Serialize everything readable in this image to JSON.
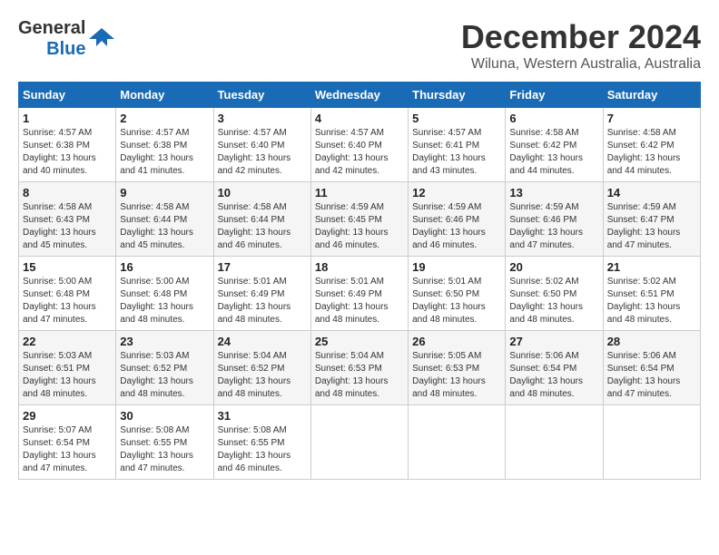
{
  "logo": {
    "line1": "General",
    "line2": "Blue"
  },
  "title": "December 2024",
  "subtitle": "Wiluna, Western Australia, Australia",
  "days_header": [
    "Sunday",
    "Monday",
    "Tuesday",
    "Wednesday",
    "Thursday",
    "Friday",
    "Saturday"
  ],
  "weeks": [
    [
      {
        "day": "1",
        "info": "Sunrise: 4:57 AM\nSunset: 6:38 PM\nDaylight: 13 hours and 40 minutes."
      },
      {
        "day": "2",
        "info": "Sunrise: 4:57 AM\nSunset: 6:38 PM\nDaylight: 13 hours and 41 minutes."
      },
      {
        "day": "3",
        "info": "Sunrise: 4:57 AM\nSunset: 6:40 PM\nDaylight: 13 hours and 42 minutes."
      },
      {
        "day": "4",
        "info": "Sunrise: 4:57 AM\nSunset: 6:40 PM\nDaylight: 13 hours and 42 minutes."
      },
      {
        "day": "5",
        "info": "Sunrise: 4:57 AM\nSunset: 6:41 PM\nDaylight: 13 hours and 43 minutes."
      },
      {
        "day": "6",
        "info": "Sunrise: 4:58 AM\nSunset: 6:42 PM\nDaylight: 13 hours and 44 minutes."
      },
      {
        "day": "7",
        "info": "Sunrise: 4:58 AM\nSunset: 6:42 PM\nDaylight: 13 hours and 44 minutes."
      }
    ],
    [
      {
        "day": "8",
        "info": "Sunrise: 4:58 AM\nSunset: 6:43 PM\nDaylight: 13 hours and 45 minutes."
      },
      {
        "day": "9",
        "info": "Sunrise: 4:58 AM\nSunset: 6:44 PM\nDaylight: 13 hours and 45 minutes."
      },
      {
        "day": "10",
        "info": "Sunrise: 4:58 AM\nSunset: 6:44 PM\nDaylight: 13 hours and 46 minutes."
      },
      {
        "day": "11",
        "info": "Sunrise: 4:59 AM\nSunset: 6:45 PM\nDaylight: 13 hours and 46 minutes."
      },
      {
        "day": "12",
        "info": "Sunrise: 4:59 AM\nSunset: 6:46 PM\nDaylight: 13 hours and 46 minutes."
      },
      {
        "day": "13",
        "info": "Sunrise: 4:59 AM\nSunset: 6:46 PM\nDaylight: 13 hours and 47 minutes."
      },
      {
        "day": "14",
        "info": "Sunrise: 4:59 AM\nSunset: 6:47 PM\nDaylight: 13 hours and 47 minutes."
      }
    ],
    [
      {
        "day": "15",
        "info": "Sunrise: 5:00 AM\nSunset: 6:48 PM\nDaylight: 13 hours and 47 minutes."
      },
      {
        "day": "16",
        "info": "Sunrise: 5:00 AM\nSunset: 6:48 PM\nDaylight: 13 hours and 48 minutes."
      },
      {
        "day": "17",
        "info": "Sunrise: 5:01 AM\nSunset: 6:49 PM\nDaylight: 13 hours and 48 minutes."
      },
      {
        "day": "18",
        "info": "Sunrise: 5:01 AM\nSunset: 6:49 PM\nDaylight: 13 hours and 48 minutes."
      },
      {
        "day": "19",
        "info": "Sunrise: 5:01 AM\nSunset: 6:50 PM\nDaylight: 13 hours and 48 minutes."
      },
      {
        "day": "20",
        "info": "Sunrise: 5:02 AM\nSunset: 6:50 PM\nDaylight: 13 hours and 48 minutes."
      },
      {
        "day": "21",
        "info": "Sunrise: 5:02 AM\nSunset: 6:51 PM\nDaylight: 13 hours and 48 minutes."
      }
    ],
    [
      {
        "day": "22",
        "info": "Sunrise: 5:03 AM\nSunset: 6:51 PM\nDaylight: 13 hours and 48 minutes."
      },
      {
        "day": "23",
        "info": "Sunrise: 5:03 AM\nSunset: 6:52 PM\nDaylight: 13 hours and 48 minutes."
      },
      {
        "day": "24",
        "info": "Sunrise: 5:04 AM\nSunset: 6:52 PM\nDaylight: 13 hours and 48 minutes."
      },
      {
        "day": "25",
        "info": "Sunrise: 5:04 AM\nSunset: 6:53 PM\nDaylight: 13 hours and 48 minutes."
      },
      {
        "day": "26",
        "info": "Sunrise: 5:05 AM\nSunset: 6:53 PM\nDaylight: 13 hours and 48 minutes."
      },
      {
        "day": "27",
        "info": "Sunrise: 5:06 AM\nSunset: 6:54 PM\nDaylight: 13 hours and 48 minutes."
      },
      {
        "day": "28",
        "info": "Sunrise: 5:06 AM\nSunset: 6:54 PM\nDaylight: 13 hours and 47 minutes."
      }
    ],
    [
      {
        "day": "29",
        "info": "Sunrise: 5:07 AM\nSunset: 6:54 PM\nDaylight: 13 hours and 47 minutes."
      },
      {
        "day": "30",
        "info": "Sunrise: 5:08 AM\nSunset: 6:55 PM\nDaylight: 13 hours and 47 minutes."
      },
      {
        "day": "31",
        "info": "Sunrise: 5:08 AM\nSunset: 6:55 PM\nDaylight: 13 hours and 46 minutes."
      },
      null,
      null,
      null,
      null
    ]
  ]
}
